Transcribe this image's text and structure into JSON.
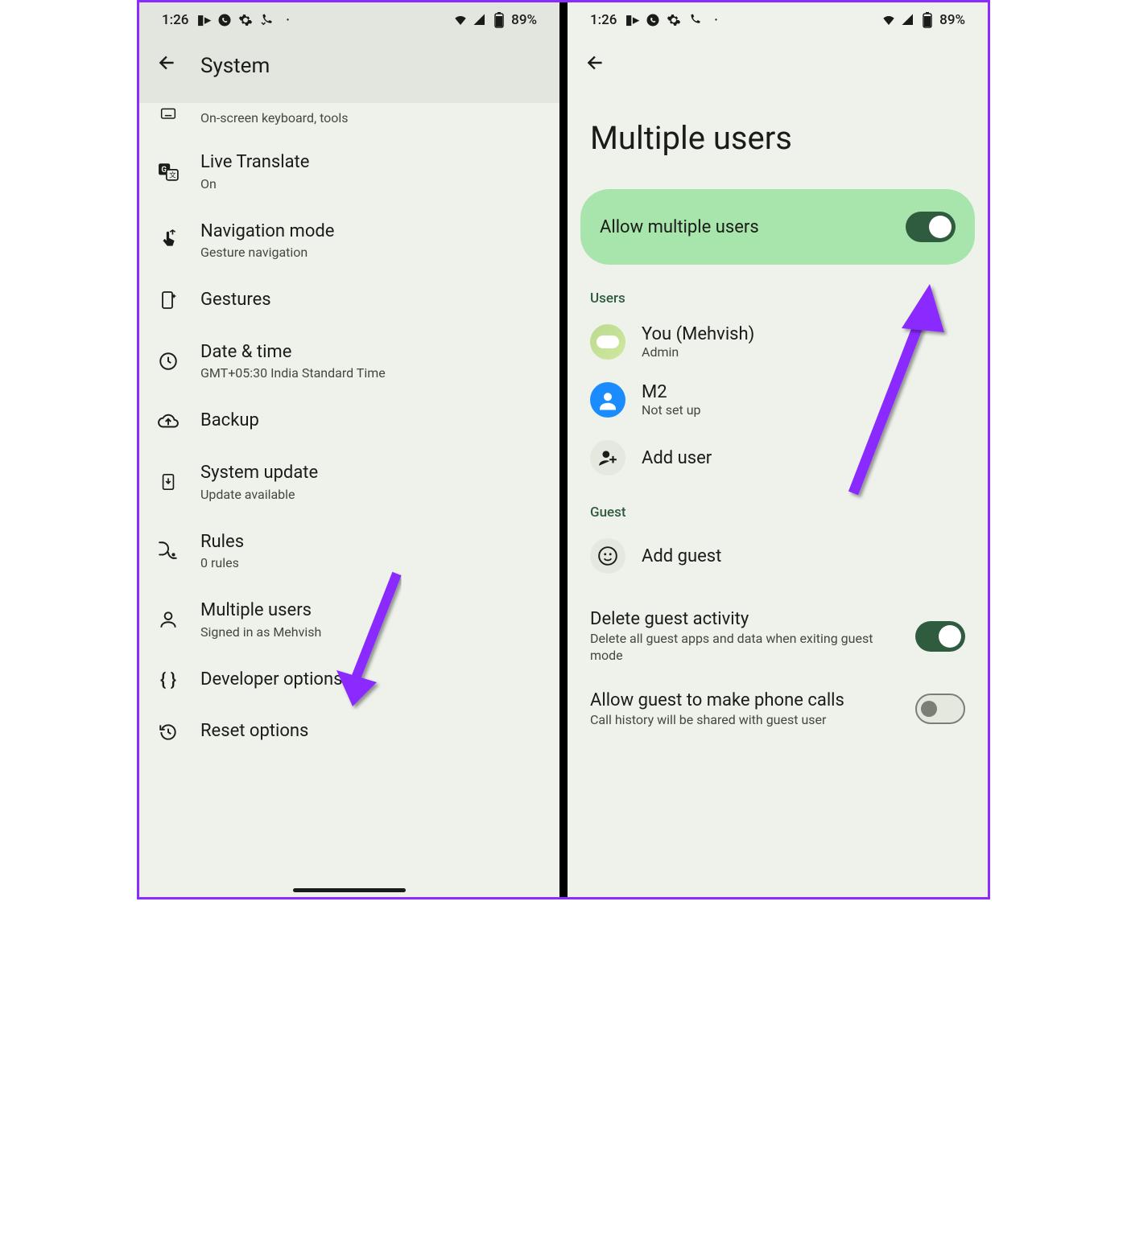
{
  "status": {
    "time": "1:26",
    "battery": "89%"
  },
  "left": {
    "title": "System",
    "items": {
      "keyboard_sub": "On-screen keyboard, tools",
      "live_translate": "Live Translate",
      "live_translate_sub": "On",
      "nav_mode": "Navigation mode",
      "nav_mode_sub": "Gesture navigation",
      "gestures": "Gestures",
      "date_time": "Date & time",
      "date_time_sub": "GMT+05:30 India Standard Time",
      "backup": "Backup",
      "system_update": "System update",
      "system_update_sub": "Update available",
      "rules": "Rules",
      "rules_sub": "0 rules",
      "multiple_users": "Multiple users",
      "multiple_users_sub": "Signed in as Mehvish",
      "developer_options": "Developer options",
      "reset_options": "Reset options"
    }
  },
  "right": {
    "title": "Multiple users",
    "allow_label": "Allow multiple users",
    "sections": {
      "users": "Users",
      "guest": "Guest"
    },
    "users": {
      "you": "You (Mehvish)",
      "you_sub": "Admin",
      "m2": "M2",
      "m2_sub": "Not set up",
      "add_user": "Add user",
      "add_guest": "Add guest"
    },
    "options": {
      "delete_guest": "Delete guest activity",
      "delete_guest_sub": "Delete all guest apps and data when exiting guest mode",
      "allow_calls": "Allow guest to make phone calls",
      "allow_calls_sub": "Call history will be shared with guest user"
    }
  },
  "annotation_color": "#8b2bff"
}
